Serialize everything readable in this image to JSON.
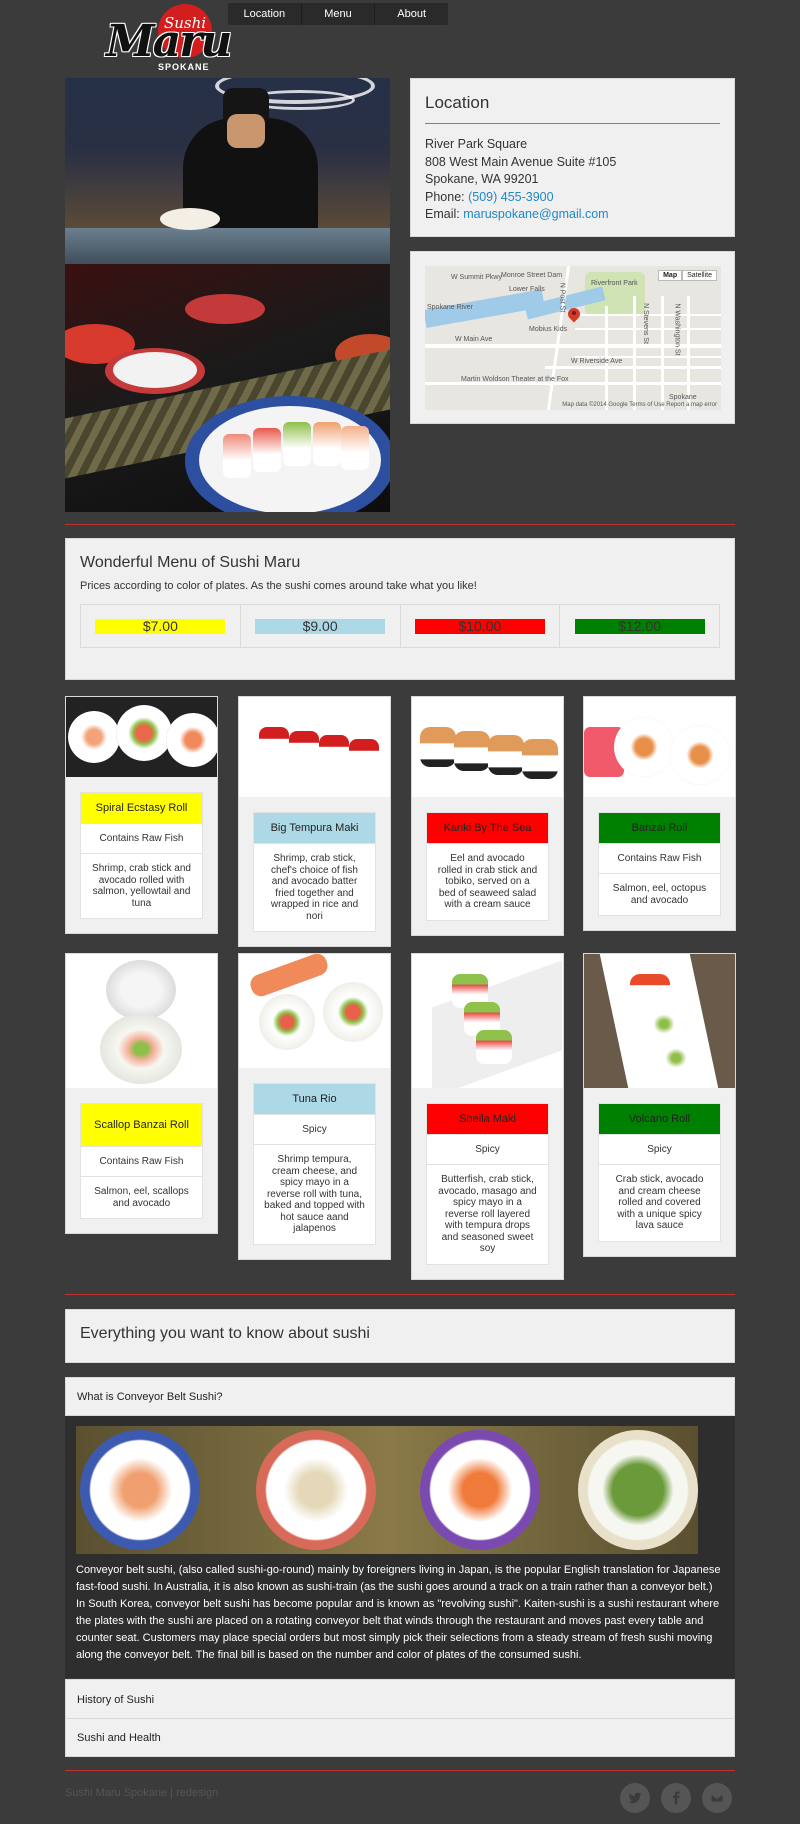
{
  "brand": {
    "sushi": "Sushi",
    "maru": "Maru",
    "spokane": "SPOKANE"
  },
  "nav": {
    "items": [
      {
        "label": "Location"
      },
      {
        "label": "Menu"
      },
      {
        "label": "About"
      }
    ]
  },
  "location": {
    "title": "Location",
    "line1": "River Park Square",
    "line2": "808 West Main Avenue Suite #105",
    "line3": "Spokane, WA 99201",
    "phone_label": "Phone: ",
    "phone": "(509) 455-3900",
    "email_label": "Email: ",
    "email": "maruspokane@gmail.com"
  },
  "map": {
    "btn_map": "Map",
    "btn_satellite": "Satellite",
    "labels": [
      "W Summit Pkwy",
      "Monroe Street Dam",
      "Lower Falls",
      "Riverfront Park",
      "Spokane River",
      "Mobius Kids",
      "W Main Ave",
      "W Riverside Ave",
      "N Stevens St",
      "N Washington St",
      "Martin Woldson Theater at the Fox",
      "Spokane",
      "N Post St"
    ],
    "footer": "Map data ©2014 Google   Terms of Use   Report a map error"
  },
  "menu": {
    "title": "Wonderful Menu of Sushi Maru",
    "subtitle": "Prices according to color of plates. As the sushi comes around take what you like!",
    "prices": [
      {
        "label": "$7.00",
        "color": "#ffff00"
      },
      {
        "label": "$9.00",
        "color": "#add8e6"
      },
      {
        "label": "$10.00",
        "color": "#ff0000"
      },
      {
        "label": "$12.00",
        "color": "#008000"
      }
    ],
    "items": [
      {
        "name": "Spiral Ecstasy Roll",
        "tag": "Contains Raw Fish",
        "desc": "Shrimp, crab stick and avocado rolled with salmon, yellowtail and tuna",
        "color": "#ffff00"
      },
      {
        "name": "Big Tempura Maki",
        "tag": "",
        "desc": "Shrimp, crab stick, chef's choice of fish and avocado batter fried together and wrapped in rice and nori",
        "color": "#add8e6"
      },
      {
        "name": "Kanki By The Sea",
        "tag": "",
        "desc": "Eel and avocado rolled in crab stick and tobiko, served on a bed of seaweed salad with a cream sauce",
        "color": "#ff0000"
      },
      {
        "name": "Banzai Roll",
        "tag": "Contains Raw Fish",
        "desc": "Salmon, eel, octopus and avocado",
        "color": "#008000"
      },
      {
        "name": "Scallop Banzai Roll",
        "tag": "Contains Raw Fish",
        "desc": "Salmon, eel, scallops and avocado",
        "color": "#ffff00"
      },
      {
        "name": "Tuna Rio",
        "tag": "Spicy",
        "desc": "Shrimp tempura, cream cheese, and spicy mayo in a reverse roll with tuna, baked and topped with hot sauce aand jalapenos",
        "color": "#add8e6"
      },
      {
        "name": "Sheila Maki",
        "tag": "Spicy",
        "desc": "Butterfish, crab stick, avocado, masago and spicy mayo in a reverse roll layered with tempura drops and seasoned sweet soy",
        "color": "#ff0000"
      },
      {
        "name": "Volcano Roll",
        "tag": "Spicy",
        "desc": "Crab stick, avocado and cream cheese rolled and covered with a unique spicy lava sauce",
        "color": "#008000"
      }
    ]
  },
  "faq": {
    "title": "Everything you want to know about sushi",
    "q1": "What is Conveyor Belt Sushi?",
    "a1": "Conveyor belt sushi, (also called sushi-go-round) mainly by foreigners living in Japan, is the popular English translation for Japanese fast-food sushi. In Australia, it is also known as sushi-train (as the sushi goes around a track on a train rather than a conveyor belt.) In South Korea, conveyor belt sushi has become popular and is known as \"revolving sushi\". Kaiten-sushi is a sushi restaurant where the plates with the sushi are placed on a rotating conveyor belt that winds through the restaurant and moves past every table and counter seat. Customers may place special orders but most simply pick their selections from a steady stream of fresh sushi moving along the conveyor belt. The final bill is based on the number and color of plates of the consumed sushi.",
    "q2": "History of Sushi",
    "q3": "Sushi and Health"
  },
  "footer": {
    "text": "Sushi Maru Spokane | redesign",
    "icons": [
      "twitter-icon",
      "facebook-icon",
      "mail-icon"
    ]
  }
}
